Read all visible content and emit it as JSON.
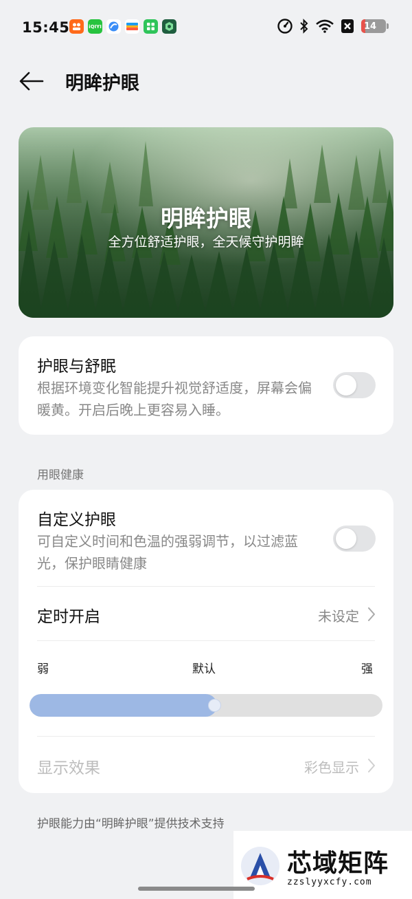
{
  "status_bar": {
    "time": "15:45",
    "battery_level": "14",
    "app_icons": [
      {
        "name": "taobao-icon",
        "color": "#ff6a1a",
        "label": ""
      },
      {
        "name": "iqiyi-icon",
        "color": "#27c33f",
        "label": "iQIYI"
      },
      {
        "name": "browser-icon",
        "color": "#3a8df7",
        "label": ""
      },
      {
        "name": "wallet-icon",
        "color": "#1e9cf0",
        "label": ""
      },
      {
        "name": "app-store-icon",
        "color": "#2fc45a",
        "label": ""
      },
      {
        "name": "security-icon",
        "color": "#1f5e3f",
        "label": ""
      }
    ]
  },
  "header": {
    "title": "明眸护眼"
  },
  "banner": {
    "title": "明眸护眼",
    "subtitle": "全方位舒适护眼，全天候守护明眸"
  },
  "eye_sleep": {
    "title": "护眼与舒眠",
    "description": "根据环境变化智能提升视觉舒适度，屏幕会偏暖黄。开启后晚上更容易入睡。",
    "enabled": false
  },
  "section_label": "用眼健康",
  "custom_eye": {
    "title": "自定义护眼",
    "description": "可自定义时间和色温的强弱调节，以过滤蓝光，保护眼睛健康",
    "enabled": false
  },
  "schedule": {
    "title": "定时开启",
    "value": "未设定"
  },
  "intensity": {
    "label_weak": "弱",
    "label_default": "默认",
    "label_strong": "强",
    "level_percent": 50
  },
  "display_effect": {
    "title": "显示效果",
    "value": "彩色显示"
  },
  "footer_note": "护眼能力由“明眸护眼”提供技术支持",
  "watermark": {
    "name": "芯域矩阵",
    "url": "zzslyyxcfy.com"
  },
  "colors": {
    "accent": "#9db8e4",
    "background": "#f0f1f3"
  }
}
